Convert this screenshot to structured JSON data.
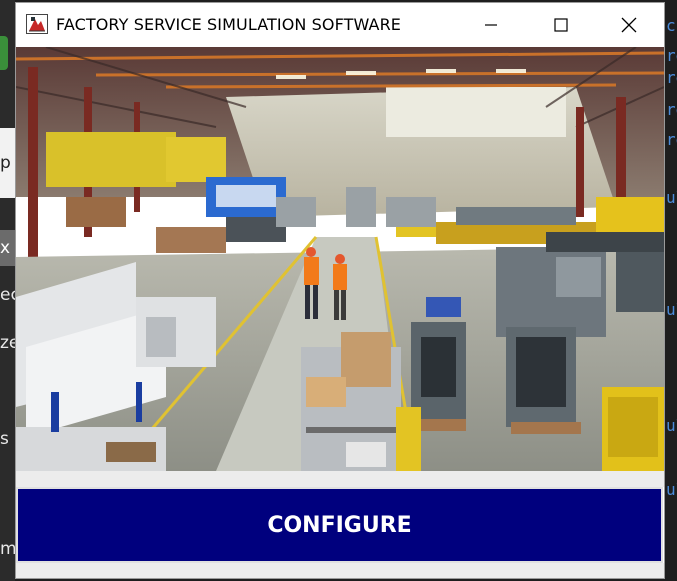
{
  "window": {
    "title": "FACTORY SERVICE SIMULATION SOFTWARE",
    "minimize_icon": "minimize-icon",
    "maximize_icon": "maximize-icon",
    "close_icon": "close-icon"
  },
  "hero": {
    "description": "factory floor photo"
  },
  "actions": {
    "configure_label": "CONFIGURE"
  },
  "background": {
    "left_fragments": [
      "p",
      "x",
      "ec",
      "ze",
      "s",
      "m"
    ],
    "right_fragments": [
      "c",
      "re",
      "re",
      "re",
      "re",
      "ul",
      "ul",
      "ul",
      "ul"
    ]
  },
  "colors": {
    "button_bg": "#00007e",
    "button_text": "#ffffff",
    "titlebar_bg": "#ffffff"
  }
}
